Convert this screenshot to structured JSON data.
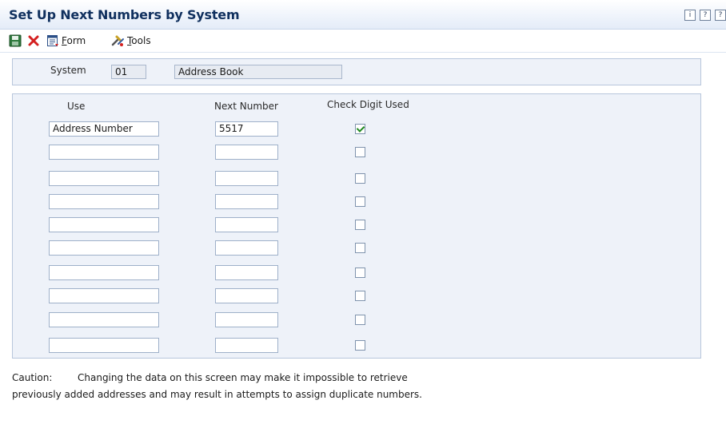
{
  "header": {
    "title": "Set Up Next Numbers by System",
    "icons": [
      "info-icon",
      "help-icon",
      "context-help-icon"
    ],
    "icon_glyphs": [
      "i",
      "?",
      "?"
    ]
  },
  "toolbar": {
    "form_label_u": "F",
    "form_label_rest": "orm",
    "tools_label_u": "T",
    "tools_label_rest": "ools"
  },
  "system": {
    "label": "System",
    "code": "01",
    "description": "Address Book"
  },
  "grid": {
    "columns": [
      "Use",
      "Next Number",
      "Check Digit Used"
    ],
    "rows": [
      {
        "use": "Address Number",
        "next_number": "5517",
        "check_digit": true
      },
      {
        "use": "",
        "next_number": "",
        "check_digit": false
      },
      {
        "use": "",
        "next_number": "",
        "check_digit": false
      },
      {
        "use": "",
        "next_number": "",
        "check_digit": false
      },
      {
        "use": "",
        "next_number": "",
        "check_digit": false
      },
      {
        "use": "",
        "next_number": "",
        "check_digit": false
      },
      {
        "use": "",
        "next_number": "",
        "check_digit": false
      },
      {
        "use": "",
        "next_number": "",
        "check_digit": false
      },
      {
        "use": "",
        "next_number": "",
        "check_digit": false
      },
      {
        "use": "",
        "next_number": "",
        "check_digit": false
      }
    ]
  },
  "caution": {
    "label": "Caution:",
    "line1": "Changing the data on this screen may make it impossible to retrieve",
    "line2": "previously added addresses and may result in attempts to assign duplicate numbers."
  },
  "colors": {
    "title": "#10305e",
    "panel_bg": "#eef2f9",
    "panel_border": "#b8c6dc",
    "check_green": "#1f8a1f",
    "cancel_red": "#d42020"
  }
}
